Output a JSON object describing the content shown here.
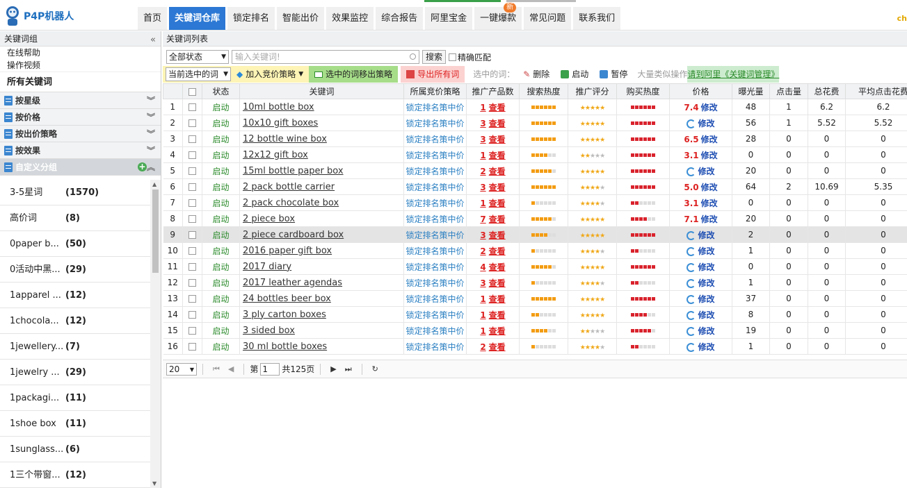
{
  "brand": {
    "name": "P4P机器人",
    "corner": "ch"
  },
  "nav": [
    {
      "label": "首页",
      "active": false
    },
    {
      "label": "关键词仓库",
      "active": true
    },
    {
      "label": "锁定排名",
      "active": false
    },
    {
      "label": "智能出价",
      "active": false
    },
    {
      "label": "效果监控",
      "active": false
    },
    {
      "label": "综合报告",
      "active": false
    },
    {
      "label": "阿里宝金",
      "active": false
    },
    {
      "label": "一键爆款",
      "active": false,
      "badge": "新"
    },
    {
      "label": "常见问题",
      "active": false
    },
    {
      "label": "联系我们",
      "active": false
    }
  ],
  "sidebar": {
    "header": "关键词组",
    "collapse": "«",
    "links": [
      "在线帮助",
      "操作视频"
    ],
    "all": "所有关键词",
    "groups": [
      "按星级",
      "按价格",
      "按出价策略",
      "按效果"
    ],
    "custom_group": "自定义分组",
    "custom_items": [
      {
        "name": "3-5星词",
        "count": "(1570)"
      },
      {
        "name": "高价词",
        "count": "(8)"
      },
      {
        "name": "0paper b...",
        "count": "(50)"
      },
      {
        "name": "0活动中黑...",
        "count": "(29)"
      },
      {
        "name": "1apparel ...",
        "count": "(12)"
      },
      {
        "name": "1chocola...",
        "count": "(12)"
      },
      {
        "name": "1jewellery...",
        "count": "(7)"
      },
      {
        "name": "1jewelry ...",
        "count": "(29)"
      },
      {
        "name": "1packagi...",
        "count": "(11)"
      },
      {
        "name": "1shoe box",
        "count": "(11)"
      },
      {
        "name": "1sunglass...",
        "count": "(6)"
      },
      {
        "name": "1三个带窗...",
        "count": "(12)"
      }
    ]
  },
  "main": {
    "title": "关键词列表",
    "status_select": "全部状态",
    "keyword_placeholder": "输入关键词!",
    "search_btn": "搜索",
    "exact_match": "精确匹配",
    "toolbar": {
      "current_select": "当前选中的词",
      "add_strategy": "加入竞价策略",
      "remove_strategy": "选中的词移出策略",
      "export": "导出所有词",
      "selected_label": "选中的词：",
      "delete": "删除",
      "start": "启动",
      "pause": "暂停",
      "bulk_label": "大量类似操作",
      "bulk_link": "请到阿里《关键词管理》"
    },
    "columns": [
      "",
      "",
      "状态",
      "关键词",
      "所属竞价策略",
      "推广产品数",
      "搜索热度",
      "推广评分",
      "购买热度",
      "价格",
      "曝光量",
      "点击量",
      "总花费",
      "平均点击花费"
    ],
    "view_label": "查看",
    "modify_label": "修改",
    "rows": [
      {
        "n": "1",
        "status": "启动",
        "kw": "10ml bottle box",
        "strat": "锁定排名策中价",
        "cnt": "1",
        "sh": 6,
        "sc": 5,
        "bh": 6,
        "price": "7.4",
        "exp": "48",
        "clk": "1",
        "cost": "6.2",
        "avg": "6.2"
      },
      {
        "n": "2",
        "status": "启动",
        "kw": "10x10 gift boxes",
        "strat": "锁定排名策中价",
        "cnt": "3",
        "sh": 6,
        "sc": 5,
        "bh": 6,
        "price": "",
        "exp": "56",
        "clk": "1",
        "cost": "5.52",
        "avg": "5.52"
      },
      {
        "n": "3",
        "status": "启动",
        "kw": "12 bottle wine box",
        "strat": "锁定排名策中价",
        "cnt": "3",
        "sh": 6,
        "sc": 5,
        "bh": 6,
        "price": "6.5",
        "exp": "28",
        "clk": "0",
        "cost": "0",
        "avg": "0"
      },
      {
        "n": "4",
        "status": "启动",
        "kw": "12x12 gift box",
        "strat": "锁定排名策中价",
        "cnt": "1",
        "sh": 4,
        "sc": 2,
        "bh": 6,
        "price": "3.1",
        "exp": "0",
        "clk": "0",
        "cost": "0",
        "avg": "0"
      },
      {
        "n": "5",
        "status": "启动",
        "kw": "15ml bottle paper box",
        "strat": "锁定排名策中价",
        "cnt": "2",
        "sh": 5,
        "sc": 5,
        "bh": 6,
        "price": "",
        "exp": "20",
        "clk": "0",
        "cost": "0",
        "avg": "0"
      },
      {
        "n": "6",
        "status": "启动",
        "kw": "2 pack bottle carrier",
        "strat": "锁定排名策中价",
        "cnt": "3",
        "sh": 6,
        "sc": 4,
        "bh": 6,
        "price": "5.0",
        "exp": "64",
        "clk": "2",
        "cost": "10.69",
        "avg": "5.35"
      },
      {
        "n": "7",
        "status": "启动",
        "kw": "2 pack chocolate box",
        "strat": "锁定排名策中价",
        "cnt": "1",
        "sh": 1,
        "sc": 4,
        "bh": 2,
        "price": "3.1",
        "exp": "0",
        "clk": "0",
        "cost": "0",
        "avg": "0"
      },
      {
        "n": "8",
        "status": "启动",
        "kw": "2 piece box",
        "strat": "锁定排名策中价",
        "cnt": "7",
        "sh": 5,
        "sc": 5,
        "bh": 4,
        "price": "7.1",
        "exp": "20",
        "clk": "0",
        "cost": "0",
        "avg": "0"
      },
      {
        "n": "9",
        "status": "启动",
        "kw": "2 piece cardboard box",
        "strat": "锁定排名策中价",
        "cnt": "3",
        "sh": 4,
        "sc": 5,
        "bh": 6,
        "price": "",
        "exp": "2",
        "clk": "0",
        "cost": "0",
        "avg": "0",
        "sel": true
      },
      {
        "n": "10",
        "status": "启动",
        "kw": "2016 paper gift box",
        "strat": "锁定排名策中价",
        "cnt": "2",
        "sh": 1,
        "sc": 4,
        "bh": 2,
        "price": "",
        "exp": "1",
        "clk": "0",
        "cost": "0",
        "avg": "0"
      },
      {
        "n": "11",
        "status": "启动",
        "kw": "2017 diary",
        "strat": "锁定排名策中价",
        "cnt": "4",
        "sh": 5,
        "sc": 5,
        "bh": 6,
        "price": "",
        "exp": "0",
        "clk": "0",
        "cost": "0",
        "avg": "0"
      },
      {
        "n": "12",
        "status": "启动",
        "kw": "2017 leather agendas",
        "strat": "锁定排名策中价",
        "cnt": "3",
        "sh": 1,
        "sc": 4,
        "bh": 2,
        "price": "",
        "exp": "1",
        "clk": "0",
        "cost": "0",
        "avg": "0"
      },
      {
        "n": "13",
        "status": "启动",
        "kw": "24 bottles beer box",
        "strat": "锁定排名策中价",
        "cnt": "1",
        "sh": 6,
        "sc": 5,
        "bh": 6,
        "price": "",
        "exp": "37",
        "clk": "0",
        "cost": "0",
        "avg": "0"
      },
      {
        "n": "14",
        "status": "启动",
        "kw": "3 ply carton boxes",
        "strat": "锁定排名策中价",
        "cnt": "1",
        "sh": 2,
        "sc": 5,
        "bh": 4,
        "price": "",
        "exp": "8",
        "clk": "0",
        "cost": "0",
        "avg": "0"
      },
      {
        "n": "15",
        "status": "启动",
        "kw": "3 sided box",
        "strat": "锁定排名策中价",
        "cnt": "1",
        "sh": 4,
        "sc": 2,
        "bh": 5,
        "price": "",
        "exp": "19",
        "clk": "0",
        "cost": "0",
        "avg": "0"
      },
      {
        "n": "16",
        "status": "启动",
        "kw": "30 ml bottle boxes",
        "strat": "锁定排名策中价",
        "cnt": "2",
        "sh": 1,
        "sc": 4,
        "bh": 2,
        "price": "",
        "exp": "1",
        "clk": "0",
        "cost": "0",
        "avg": "0"
      }
    ],
    "pager": {
      "page_size": "20",
      "page_label": "第",
      "page": "1",
      "total": "共125页"
    }
  },
  "colors": {
    "accent": "#2c78d4",
    "heat": "#f39c12",
    "buy": "#d9232d",
    "star": "#f0a818"
  }
}
